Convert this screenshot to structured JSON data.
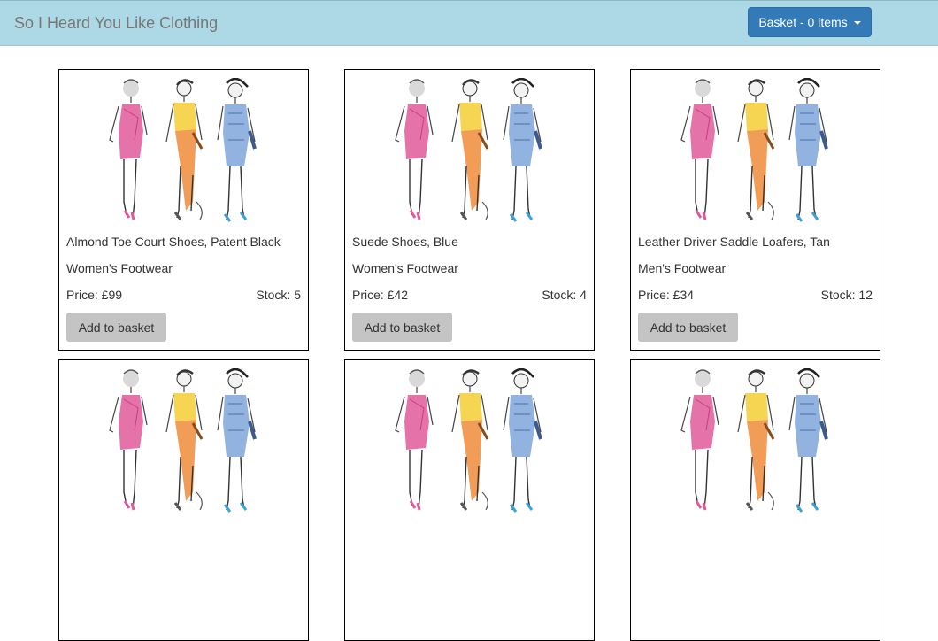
{
  "header": {
    "brand": "So I Heard You Like Clothing",
    "basket_label": "Basket - 0 items"
  },
  "products": [
    {
      "name": "Almond Toe Court Shoes, Patent Black",
      "category": "Women's Footwear",
      "price": "Price: £99",
      "stock": "Stock: 5",
      "add_label": "Add to basket"
    },
    {
      "name": "Suede Shoes, Blue",
      "category": "Women's Footwear",
      "price": "Price: £42",
      "stock": "Stock: 4",
      "add_label": "Add to basket"
    },
    {
      "name": "Leather Driver Saddle Loafers, Tan",
      "category": "Men's Footwear",
      "price": "Price: £34",
      "stock": "Stock: 12",
      "add_label": "Add to basket"
    }
  ],
  "colors": {
    "navbar_bg": "#add8e6",
    "basket_button": "#337ab7",
    "add_button": "#c4c4c4"
  }
}
